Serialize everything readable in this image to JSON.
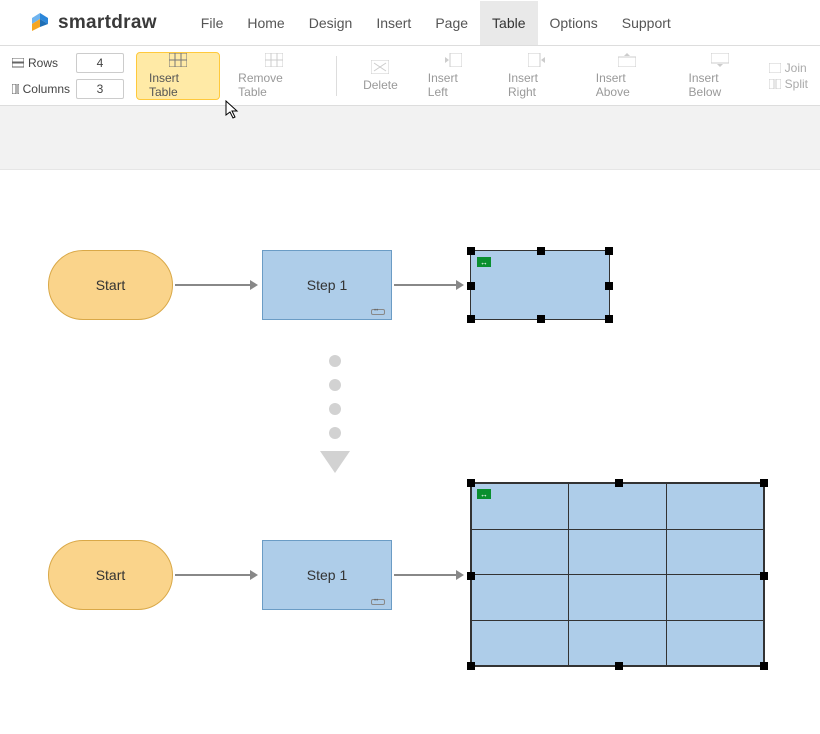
{
  "app": {
    "name": "smartdraw"
  },
  "menu": {
    "items": [
      "File",
      "Home",
      "Design",
      "Insert",
      "Page",
      "Table",
      "Options",
      "Support"
    ],
    "active_index": 5
  },
  "toolbar": {
    "rows_label": "Rows",
    "rows_value": "4",
    "cols_label": "Columns",
    "cols_value": "3",
    "insert_table": "Insert Table",
    "remove_table": "Remove Table",
    "delete": "Delete",
    "insert_left": "Insert Left",
    "insert_right": "Insert Right",
    "insert_above": "Insert Above",
    "insert_below": "Insert Below",
    "join": "Join",
    "split": "Split"
  },
  "shapes": {
    "start": "Start",
    "step1": "Step 1"
  },
  "table_config": {
    "rows": 4,
    "cols": 3
  }
}
